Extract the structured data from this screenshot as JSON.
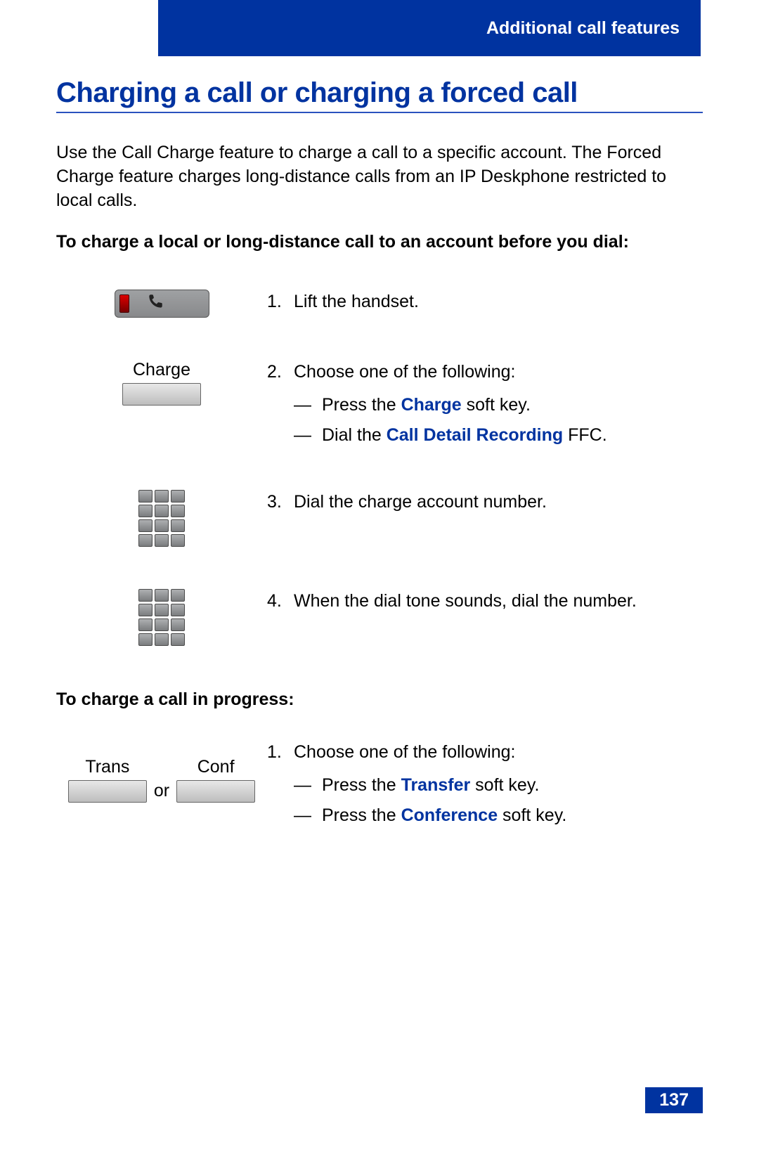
{
  "header": {
    "section": "Additional call features"
  },
  "title": "Charging a call or charging a forced call",
  "intro": "Use the Call Charge feature to charge a call to a specific account. The Forced Charge feature charges long-distance calls from an IP Deskphone restricted to local calls.",
  "proc1": {
    "heading": "To charge a local or long-distance call to an account before you dial:",
    "steps": [
      {
        "num": "1.",
        "text": "Lift the handset."
      },
      {
        "num": "2.",
        "text": "Choose one of the following:",
        "softkey_label": "Charge",
        "bullets": [
          {
            "pre": "Press the ",
            "term": "Charge",
            "post": " soft key."
          },
          {
            "pre": "Dial the ",
            "term": "Call Detail Recording",
            "post": " FFC."
          }
        ]
      },
      {
        "num": "3.",
        "text": "Dial the charge account number."
      },
      {
        "num": "4.",
        "text": "When the dial tone sounds, dial the number."
      }
    ]
  },
  "proc2": {
    "heading": "To charge a call in progress:",
    "steps": [
      {
        "num": "1.",
        "text": "Choose one of the following:",
        "left_key": "Trans",
        "or": "or",
        "right_key": "Conf",
        "bullets": [
          {
            "pre": "Press the ",
            "term": "Transfer",
            "post": " soft key."
          },
          {
            "pre": "Press the ",
            "term": "Conference",
            "post": " soft key."
          }
        ]
      }
    ]
  },
  "page_number": "137"
}
